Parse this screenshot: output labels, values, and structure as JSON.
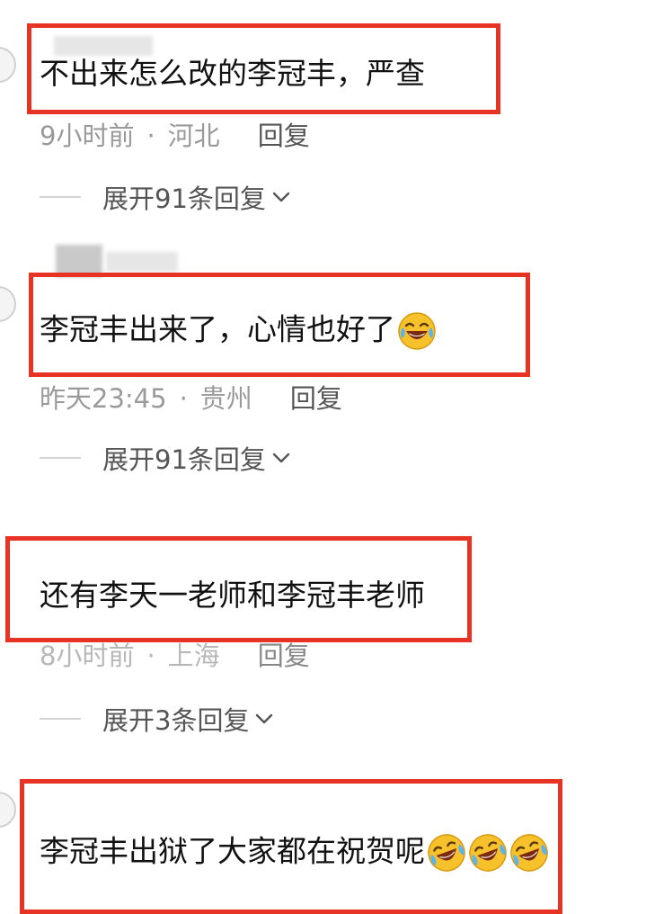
{
  "comments": [
    {
      "text": "不出来怎么改的李冠丰，严查",
      "time": "9小时前",
      "location": "河北",
      "reply_label": "回复",
      "expand_label": "展开91条回复",
      "emoji": []
    },
    {
      "text": "李冠丰出来了，心情也好了",
      "time": "昨天23:45",
      "location": "贵州",
      "reply_label": "回复",
      "expand_label": "展开91条回复",
      "emoji": [
        "laughing-tears-emoji"
      ]
    },
    {
      "text": "还有李天一老师和李冠丰老师",
      "time": "8小时前",
      "location": "上海",
      "reply_label": "回复",
      "expand_label": "展开3条回复",
      "emoji": []
    },
    {
      "text": "李冠丰出狱了大家都在祝贺呢",
      "emoji": [
        "rofl-emoji",
        "rofl-emoji",
        "rofl-emoji"
      ]
    }
  ],
  "colors": {
    "highlight_box": "#e63323",
    "meta_text": "#9a9a9a",
    "emoji_face": "#f7c12c"
  }
}
